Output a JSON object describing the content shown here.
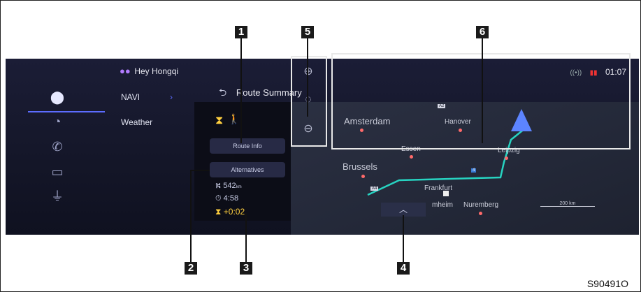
{
  "assistant": {
    "label": "Hey Hongqi",
    "icon": "assistant-dots-icon"
  },
  "status": {
    "time": "01:07",
    "signal_icon": "signal-icon",
    "warning_icon": "no-signal-icon"
  },
  "nav_menu": [
    {
      "label": "NAVI",
      "selected": true
    },
    {
      "label": "Weather",
      "selected": false
    }
  ],
  "route": {
    "title": "Route Summary",
    "route_info_button": "Route Info",
    "alternatives_button": "Alternatives",
    "distance": "542",
    "distance_unit": "km",
    "duration": "4:58",
    "delay": "+0:02"
  },
  "map": {
    "cities": [
      "Amsterdam",
      "Hanover",
      "Essen",
      "Leipzig",
      "Brussels",
      "Frankfurt",
      "Nuremberg",
      "mheim"
    ],
    "highways": [
      "A2",
      "A4",
      "4"
    ],
    "scale": "200 km",
    "route_color": "#27d3c1"
  },
  "callouts": [
    "1",
    "2",
    "3",
    "4",
    "5",
    "6"
  ],
  "figure_ref": "S90491O"
}
